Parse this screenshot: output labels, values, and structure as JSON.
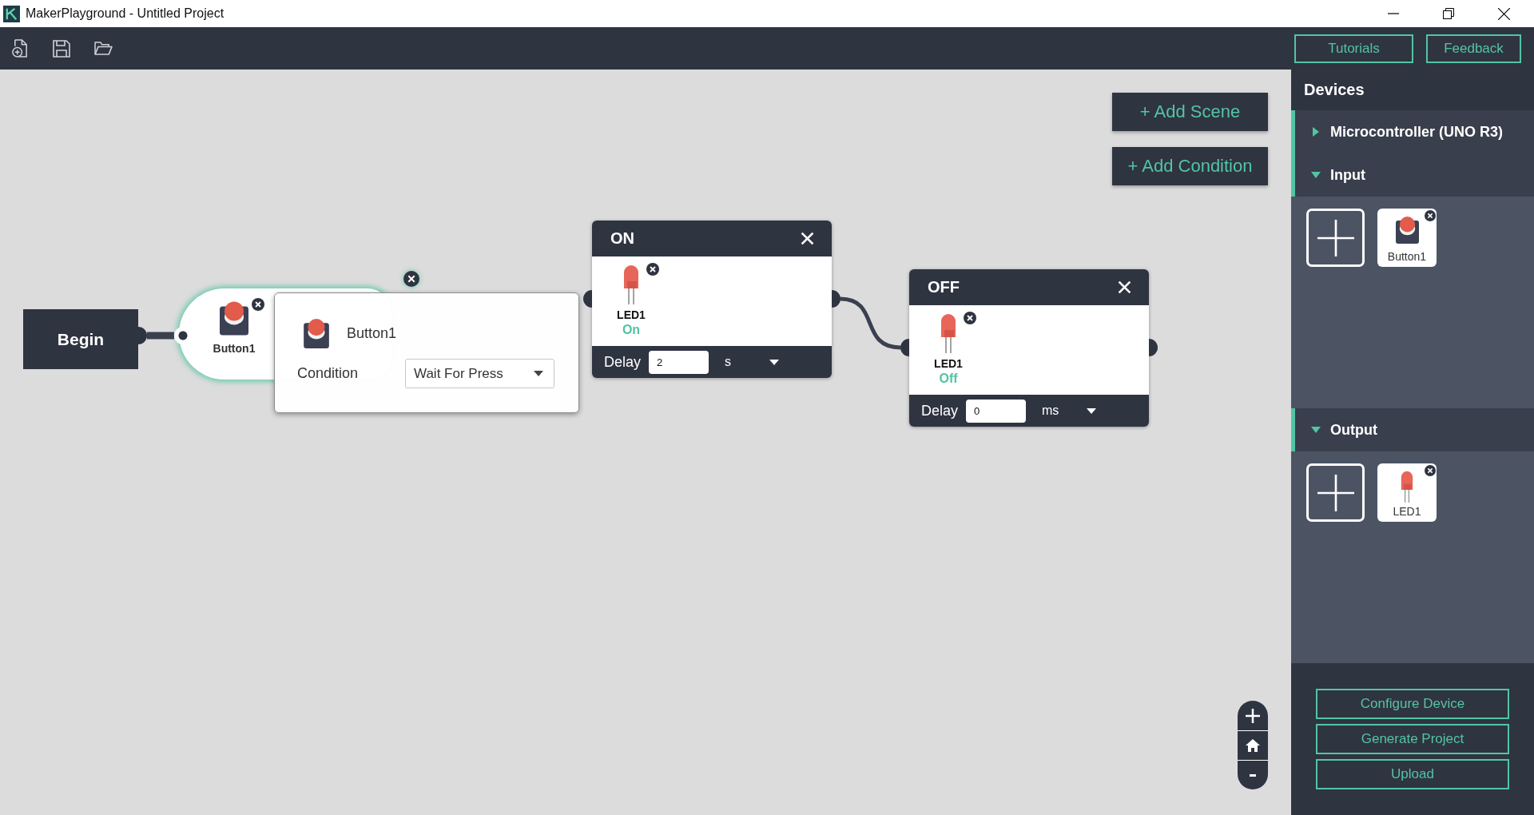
{
  "window": {
    "title": "MakerPlayground - Untitled Project"
  },
  "toolbar": {
    "tutorials_button": "Tutorials",
    "feedback_button": "Feedback"
  },
  "canvas": {
    "add_scene_button": "+ Add Scene",
    "add_condition_button": "+ Add Condition",
    "begin": {
      "label": "Begin"
    },
    "condition": {
      "device": {
        "name": "Button1",
        "kind": "button"
      },
      "popup": {
        "device": {
          "name": "Button1",
          "kind": "button"
        },
        "label": "Condition",
        "value": "Wait For Press"
      }
    },
    "scenes": [
      {
        "title": "ON",
        "devices": [
          {
            "name": "LED1",
            "kind": "led",
            "state": "On"
          }
        ],
        "delay_label": "Delay",
        "delay": "2",
        "unit": "s"
      },
      {
        "title": "OFF",
        "devices": [
          {
            "name": "LED1",
            "kind": "led",
            "state": "Off"
          }
        ],
        "delay_label": "Delay",
        "delay": "0",
        "unit": "ms"
      }
    ]
  },
  "sidebar": {
    "title": "Devices",
    "sections": [
      {
        "label": "Microcontroller (UNO R3)",
        "expanded": false
      },
      {
        "label": "Input",
        "expanded": true,
        "devices": [
          {
            "name": "Button1",
            "kind": "button"
          }
        ]
      },
      {
        "label": "Output",
        "expanded": true,
        "devices": [
          {
            "name": "LED1",
            "kind": "led"
          }
        ]
      }
    ],
    "configure_button": "Configure Device",
    "generate_button": "Generate Project",
    "upload_button": "Upload"
  }
}
